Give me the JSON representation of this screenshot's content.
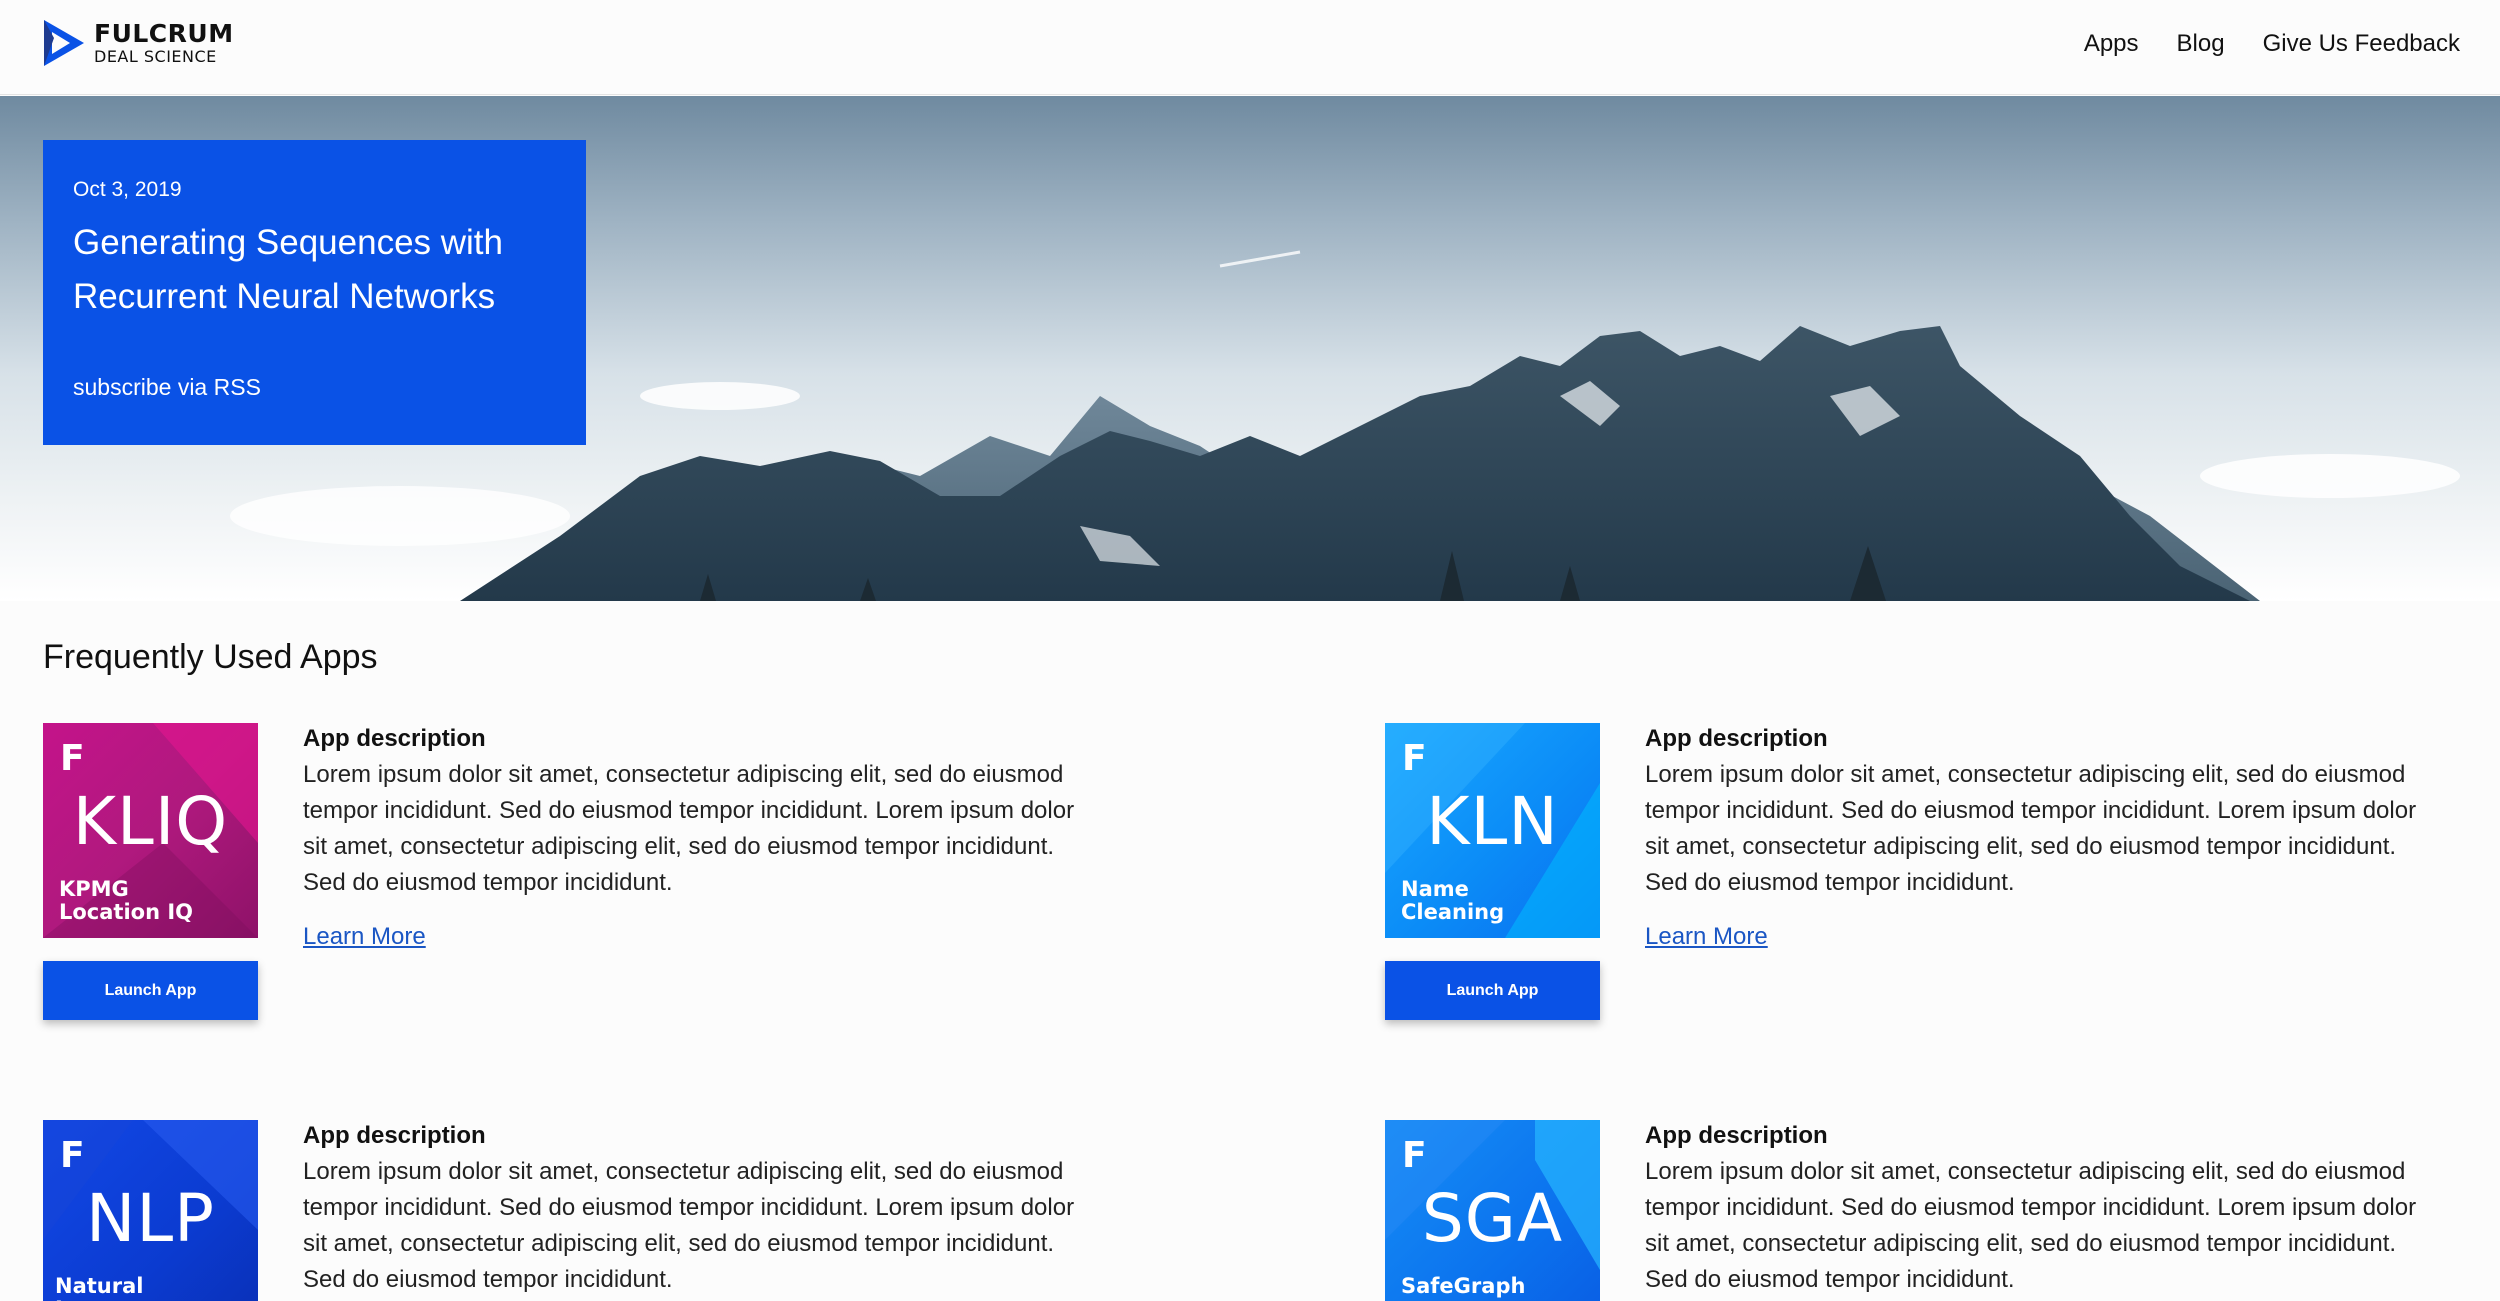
{
  "brand": {
    "name": "FULCRUM",
    "sub": "DEAL SCIENCE"
  },
  "nav": {
    "apps": "Apps",
    "blog": "Blog",
    "feedback": "Give Us Feedback"
  },
  "hero": {
    "date": "Oct 3, 2019",
    "title": "Generating Sequences with Recurrent Neural Networks",
    "rss": "subscribe via RSS"
  },
  "section_title": "Frequently Used Apps",
  "apps": [
    {
      "code": "KLIQ",
      "sub1": "KPMG",
      "sub2": "Location IQ",
      "heading": "App description",
      "description": "Lorem ipsum dolor sit amet, consectetur adipiscing elit, sed do eiusmod tempor incididunt. Sed do eiusmod tempor incididunt. Lorem ipsum dolor sit amet, consectetur adipiscing elit, sed do eiusmod tempor incididunt. Sed do eiusmod tempor incididunt.",
      "learn_more": "Learn More",
      "launch": "Launch App",
      "color": "#b0197e"
    },
    {
      "code": "KLN",
      "sub1": "Name",
      "sub2": "Cleaning",
      "heading": "App description",
      "description": "Lorem ipsum dolor sit amet, consectetur adipiscing elit, sed do eiusmod tempor incididunt. Sed do eiusmod tempor incididunt. Lorem ipsum dolor sit amet, consectetur adipiscing elit, sed do eiusmod tempor incididunt. Sed do eiusmod tempor incididunt.",
      "learn_more": "Learn More",
      "launch": "Launch App",
      "color": "#0b8cf7"
    },
    {
      "code": "NLP",
      "sub1": "Natural Language",
      "sub2": "",
      "heading": "App description",
      "description": "Lorem ipsum dolor sit amet, consectetur adipiscing elit, sed do eiusmod tempor incididunt. Sed do eiusmod tempor incididunt. Lorem ipsum dolor sit amet, consectetur adipiscing elit, sed do eiusmod tempor incididunt. Sed do eiusmod tempor incididunt.",
      "color": "#0b3bd0"
    },
    {
      "code": "SGA",
      "sub1": "SafeGraph",
      "sub2": "",
      "heading": "App description",
      "description": "Lorem ipsum dolor sit amet, consectetur adipiscing elit, sed do eiusmod tempor incididunt. Sed do eiusmod tempor incididunt. Lorem ipsum dolor sit amet, consectetur adipiscing elit, sed do eiusmod tempor incididunt. Sed do eiusmod tempor incididunt.",
      "color": "#0b72ee"
    }
  ],
  "colors": {
    "accent": "#0a52e6",
    "link": "#1a56c4"
  }
}
